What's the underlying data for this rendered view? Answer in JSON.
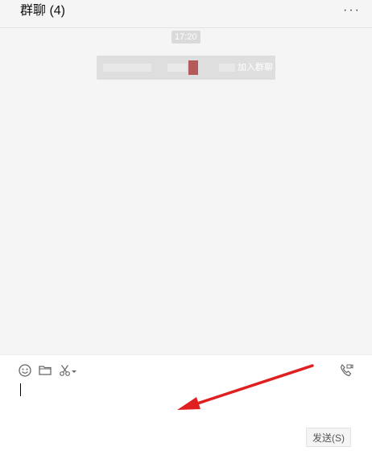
{
  "header": {
    "title": "群聊 (4)",
    "more_label": "···"
  },
  "chat": {
    "timestamp": "17:20",
    "system_message": {
      "text": "加入群聊"
    }
  },
  "composer": {
    "toolbar": {
      "icons": [
        "emoji-icon",
        "folder-icon",
        "scissors-icon",
        "dropdown-caret-icon",
        "video-call-icon"
      ]
    },
    "input_value": "",
    "send_label": "发送(S)"
  },
  "colors": {
    "annotation_arrow": "#e02020",
    "background": "#f5f5f5",
    "composer_bg": "#ffffff"
  }
}
